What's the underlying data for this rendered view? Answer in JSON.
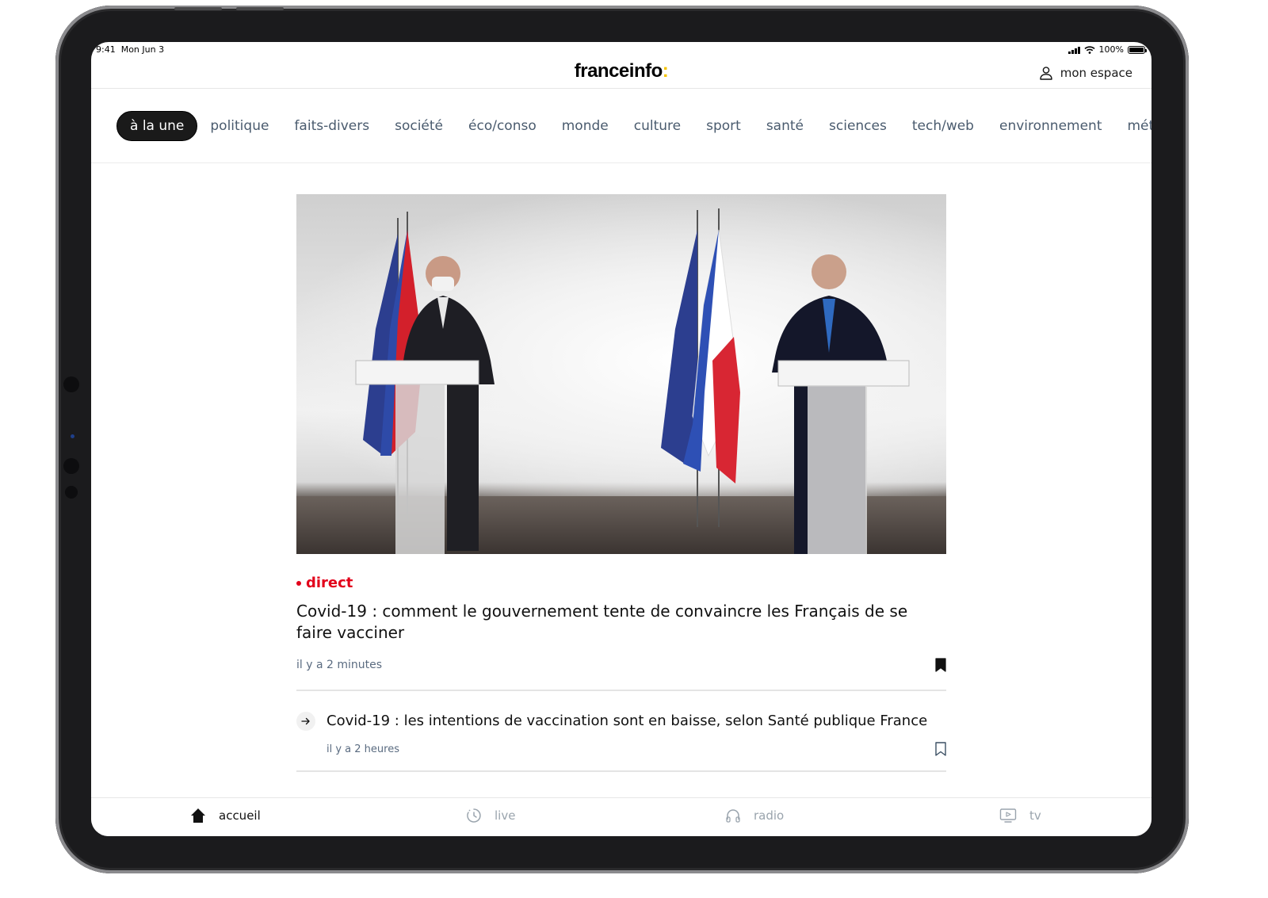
{
  "status_bar": {
    "time": "9:41",
    "date": "Mon Jun 3",
    "battery": "100%"
  },
  "header": {
    "logo_text": "franceinfo",
    "logo_accent": ":",
    "account_label": "mon espace"
  },
  "tabs": [
    {
      "label": "à la une",
      "active": true
    },
    {
      "label": "politique"
    },
    {
      "label": "faits-divers"
    },
    {
      "label": "société"
    },
    {
      "label": "éco/conso"
    },
    {
      "label": "monde"
    },
    {
      "label": "culture"
    },
    {
      "label": "sport"
    },
    {
      "label": "santé"
    },
    {
      "label": "sciences"
    },
    {
      "label": "tech/web"
    },
    {
      "label": "environnement"
    },
    {
      "label": "météo"
    }
  ],
  "main_article": {
    "badge": "direct",
    "title": "Covid-19 : comment le gouvernement tente de convaincre les Français de se faire vacciner",
    "time": "il y a 2 minutes",
    "bookmarked": true
  },
  "secondary_article": {
    "title": "Covid-19 : les intentions de vaccination sont en baisse, selon Santé publique France",
    "time": "il y a 2 heures",
    "bookmarked": false
  },
  "bottom_nav": [
    {
      "label": "accueil",
      "icon": "home-icon",
      "active": true
    },
    {
      "label": "live",
      "icon": "clock-icon"
    },
    {
      "label": "radio",
      "icon": "headphones-icon"
    },
    {
      "label": "tv",
      "icon": "tv-icon"
    }
  ],
  "colors": {
    "brand_accent": "#f5c400",
    "live_red": "#e2001a",
    "tab_text": "#4a5b6e",
    "active_tab_bg": "#1a1a1a"
  }
}
